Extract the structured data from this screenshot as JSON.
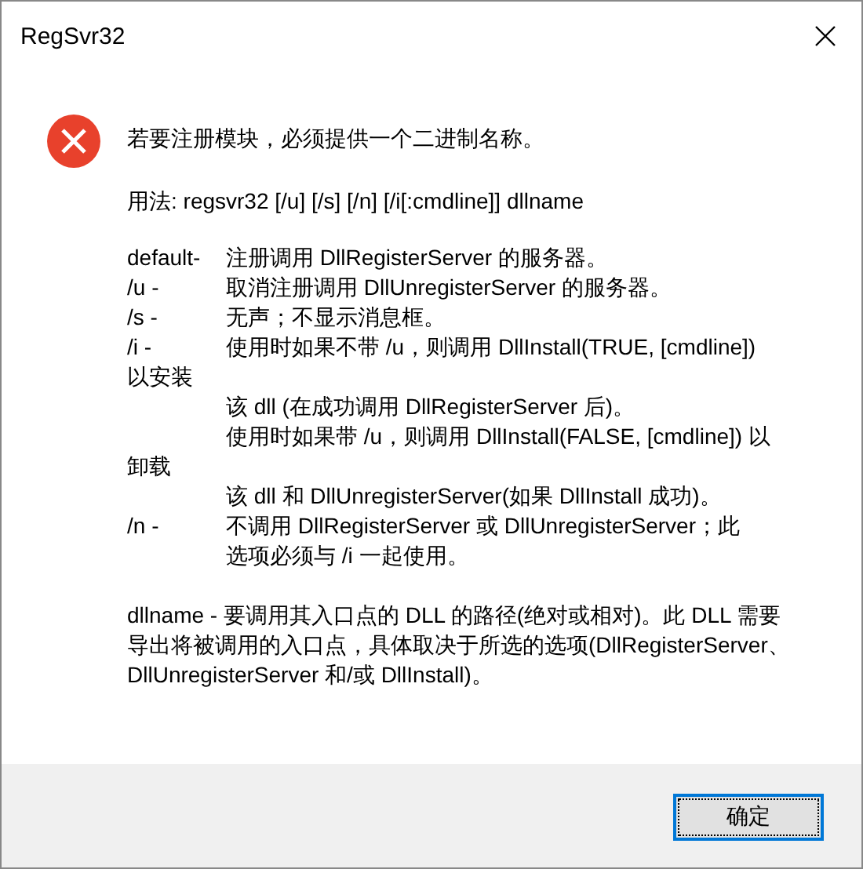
{
  "window": {
    "title": "RegSvr32"
  },
  "message": "若要注册模块，必须提供一个二进制名称。",
  "usage": "用法: regsvr32 [/u] [/s] [/n] [/i[:cmdline]] dllname",
  "options": [
    {
      "kind": "option",
      "switch": "default-",
      "text": "注册调用 DllRegisterServer 的服务器。"
    },
    {
      "kind": "option",
      "switch": "/u -",
      "text": "取消注册调用 DllUnregisterServer 的服务器。"
    },
    {
      "kind": "option",
      "switch": "/s -",
      "text": "无声；不显示消息框。"
    },
    {
      "kind": "option",
      "switch": "/i -",
      "text": "使用时如果不带 /u，则调用 DllInstall(TRUE, [cmdline])"
    },
    {
      "kind": "wrap",
      "text": "以安装"
    },
    {
      "kind": "continuation",
      "text": "该 dll (在成功调用 DllRegisterServer 后)。"
    },
    {
      "kind": "continuation",
      "text": "使用时如果带 /u，则调用 DllInstall(FALSE, [cmdline]) 以"
    },
    {
      "kind": "wrap",
      "text": "卸载"
    },
    {
      "kind": "continuation",
      "text": "该 dll 和 DllUnregisterServer(如果 DllInstall 成功)。"
    },
    {
      "kind": "option",
      "switch": "/n -",
      "text": "不调用 DllRegisterServer 或 DllUnregisterServer；此"
    },
    {
      "kind": "continuation",
      "text": "选项必须与 /i 一起使用。"
    }
  ],
  "note": [
    "dllname - 要调用其入口点的 DLL 的路径(绝对或相对)。此 DLL 需要",
    "导出将被调用的入口点，具体取决于所选的选项(DllRegisterServer、",
    "DllUnregisterServer 和/或 DllInstall)。"
  ],
  "buttons": [
    {
      "label": "确定",
      "selected": true
    }
  ]
}
